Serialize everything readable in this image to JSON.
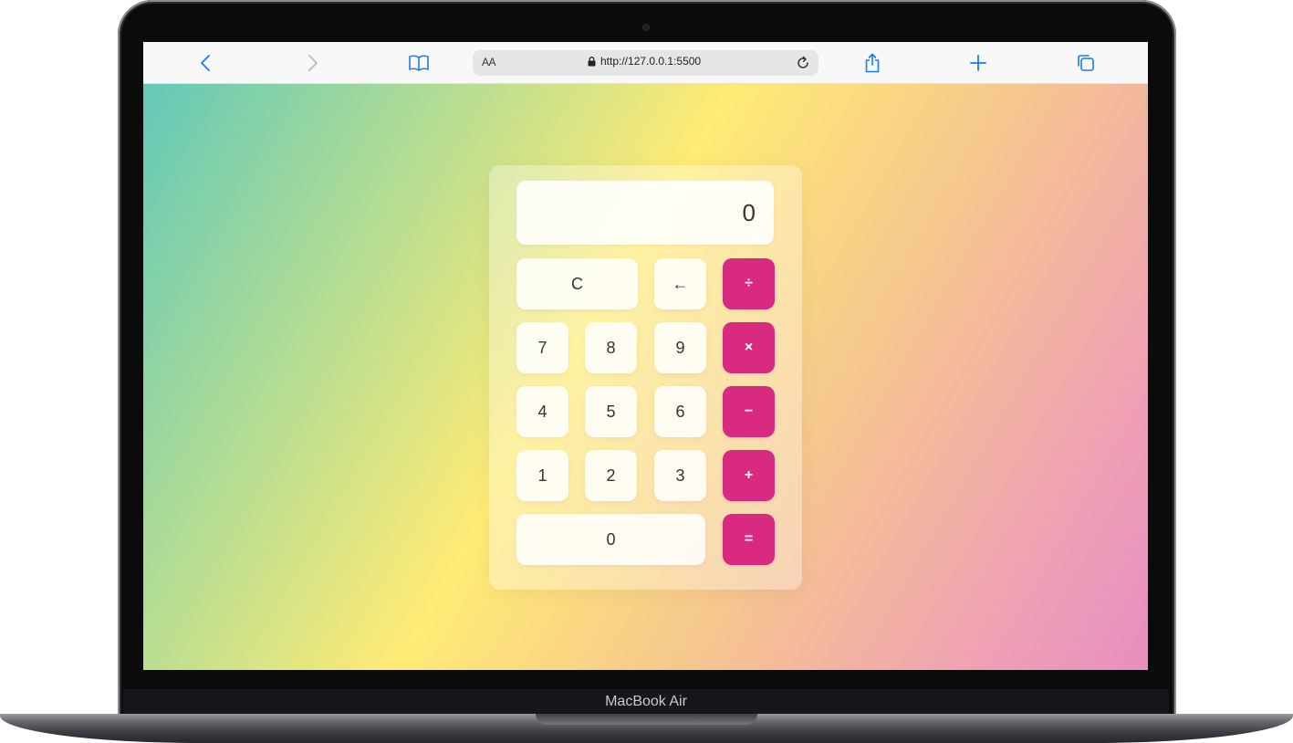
{
  "device": {
    "label": "MacBook Air"
  },
  "browser": {
    "text_size_label": "AA",
    "url": "http://127.0.0.1:5500",
    "icons": {
      "back": "chevron-left-icon",
      "forward": "chevron-right-icon",
      "bookmarks": "book-icon",
      "lock": "lock-icon",
      "reload": "reload-icon",
      "share": "share-icon",
      "new_tab": "plus-icon",
      "tabs": "tabs-icon"
    },
    "accent_color": "#1a7bf2"
  },
  "calculator": {
    "display": "0",
    "operator_color": "#d72a80",
    "keys": {
      "clear": "C",
      "backspace": "←",
      "divide": "÷",
      "seven": "7",
      "eight": "8",
      "nine": "9",
      "multiply": "×",
      "four": "4",
      "five": "5",
      "six": "6",
      "subtract": "−",
      "one": "1",
      "two": "2",
      "three": "3",
      "add": "+",
      "zero": "0",
      "equals": "="
    }
  }
}
